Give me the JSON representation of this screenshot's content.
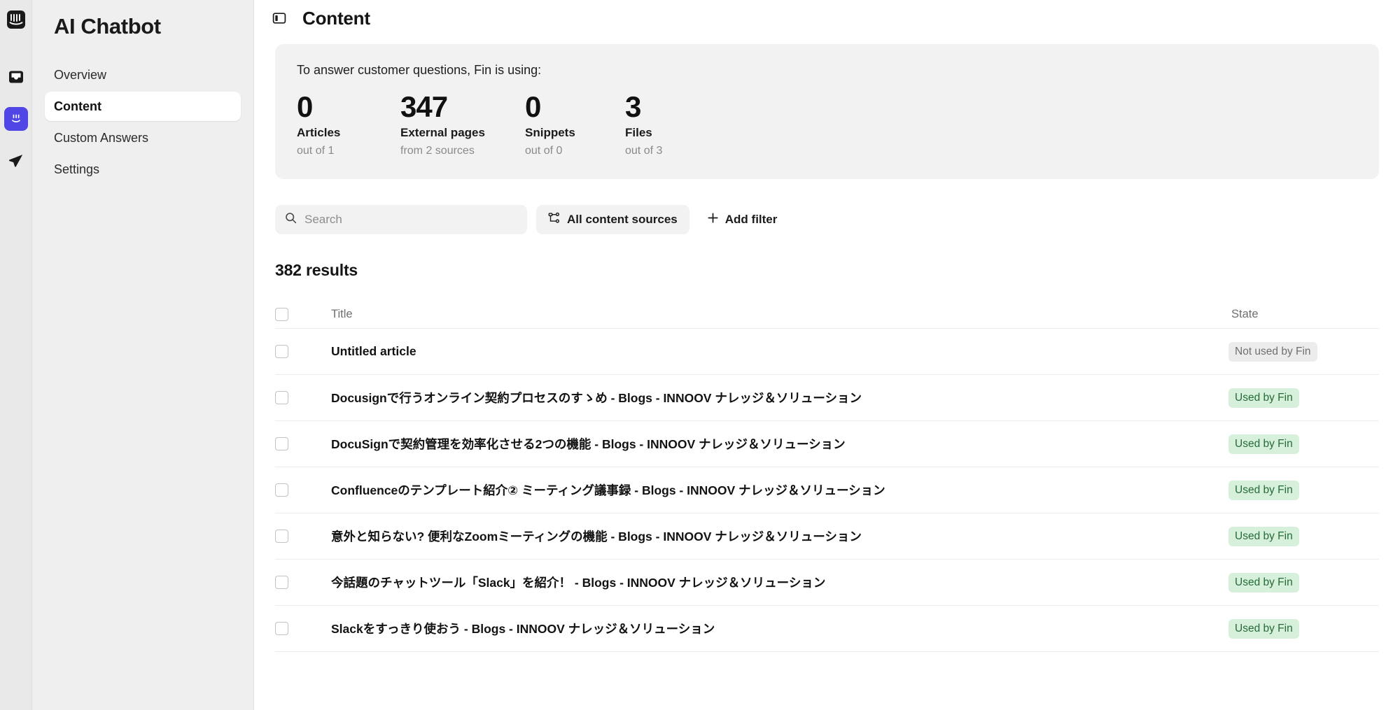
{
  "rail": {
    "items": [
      {
        "name": "intercom-logo-icon",
        "label": "Intercom"
      },
      {
        "name": "inbox-icon",
        "label": "Inbox"
      },
      {
        "name": "fin-ai-icon",
        "label": "Fin AI"
      },
      {
        "name": "outbound-icon",
        "label": "Outbound"
      }
    ]
  },
  "sidebar": {
    "title": "AI Chatbot",
    "items": [
      {
        "label": "Overview",
        "active": false
      },
      {
        "label": "Content",
        "active": true
      },
      {
        "label": "Custom Answers",
        "active": false
      },
      {
        "label": "Settings",
        "active": false
      }
    ]
  },
  "header": {
    "panel_toggle_icon": "side-panel-icon",
    "title": "Content"
  },
  "stats": {
    "lead": "To answer customer questions, Fin is using:",
    "items": [
      {
        "value": "0",
        "label": "Articles",
        "sub": "out of 1"
      },
      {
        "value": "347",
        "label": "External pages",
        "sub": "from 2 sources"
      },
      {
        "value": "0",
        "label": "Snippets",
        "sub": "out of 0"
      },
      {
        "value": "3",
        "label": "Files",
        "sub": "out of 3"
      }
    ]
  },
  "filters": {
    "search_placeholder": "Search",
    "search_value": "",
    "search_icon": "search-icon",
    "sources_button": "All content sources",
    "sources_icon": "content-sources-icon",
    "add_filter_button": "Add filter",
    "add_filter_icon": "plus-icon"
  },
  "results": {
    "count_label": "382 results",
    "columns": {
      "title": "Title",
      "state": "State"
    },
    "rows": [
      {
        "title": "Untitled article",
        "state": "Not used by Fin",
        "state_kind": "notused"
      },
      {
        "title": "Docusignで行うオンライン契約プロセスのすゝめ - Blogs - INNOOV ナレッジ＆ソリューション",
        "state": "Used by Fin",
        "state_kind": "used"
      },
      {
        "title": "DocuSignで契約管理を効率化させる2つの機能 - Blogs - INNOOV ナレッジ＆ソリューション",
        "state": "Used by Fin",
        "state_kind": "used"
      },
      {
        "title": "Confluenceのテンプレート紹介② ミーティング議事録 - Blogs - INNOOV ナレッジ＆ソリューション",
        "state": "Used by Fin",
        "state_kind": "used"
      },
      {
        "title": "意外と知らない? 便利なZoomミーティングの機能 - Blogs - INNOOV ナレッジ＆ソリューション",
        "state": "Used by Fin",
        "state_kind": "used"
      },
      {
        "title": "今話題のチャットツール「Slack」を紹介！ - Blogs - INNOOV ナレッジ＆ソリューション",
        "state": "Used by Fin",
        "state_kind": "used"
      },
      {
        "title": "Slackをすっきり使おう - Blogs - INNOOV ナレッジ＆ソリューション",
        "state": "Used by Fin",
        "state_kind": "used"
      }
    ]
  },
  "colors": {
    "accent_blue": "#4f46e5",
    "badge_used_bg": "#d6f0db",
    "badge_used_text": "#256b37",
    "badge_notused_bg": "#ececec",
    "badge_notused_text": "#707070",
    "sidebar_bg": "#efefef",
    "card_bg": "#f2f2f2"
  }
}
